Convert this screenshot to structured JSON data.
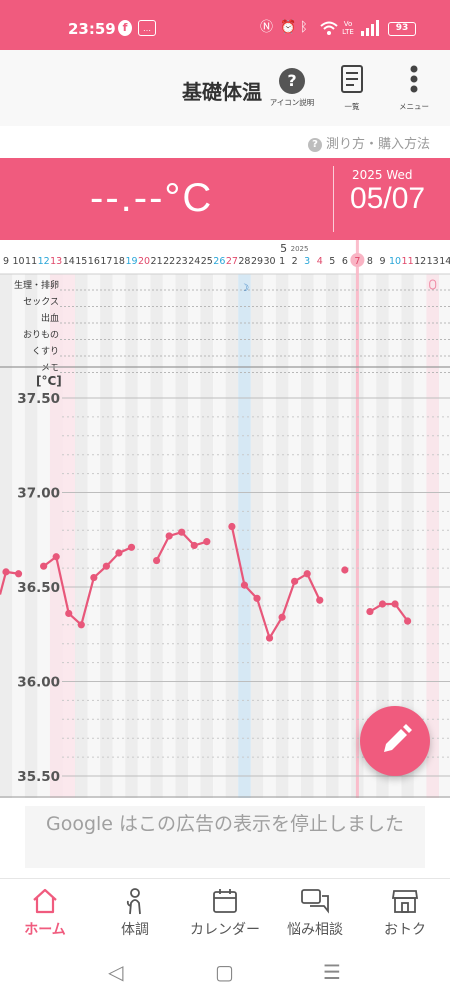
{
  "status_bar": {
    "time": "23:59",
    "battery": "93",
    "left_icons": [
      "facebook-icon",
      "message-icon"
    ],
    "right_icons": [
      "nfc-icon",
      "alarm-icon",
      "bluetooth-icon",
      "wifi-icon",
      "volte-icon",
      "signal-icon"
    ]
  },
  "header": {
    "title": "基礎体温",
    "help_label": "アイコン説明",
    "list_label": "一覧",
    "menu_label": "メニュー"
  },
  "howto": {
    "label": "測り方・購入方法"
  },
  "banner": {
    "temperature": "--.--°C",
    "year_day": "2025 Wed",
    "date": "05/07"
  },
  "chart": {
    "month_label": "5",
    "year_label": "2025",
    "day_labels": [
      "9",
      "10",
      "11",
      "12",
      "13",
      "14",
      "15",
      "16",
      "17",
      "18",
      "19",
      "20",
      "21",
      "22",
      "23",
      "24",
      "25",
      "26",
      "27",
      "28",
      "29",
      "30",
      "1",
      "2",
      "3",
      "4",
      "5",
      "6",
      "7",
      "8",
      "9",
      "10",
      "11",
      "12",
      "13",
      "14"
    ],
    "row_labels": [
      "生理・排卵",
      "セックス",
      "出血",
      "おりもの",
      "くすり",
      "メモ"
    ],
    "unit_label": "[°C]",
    "y_labels": [
      "37.50",
      "37.00",
      "36.50",
      "36.00",
      "35.50"
    ]
  },
  "chart_data": {
    "type": "line",
    "title": "",
    "xlabel": "",
    "ylabel": "[°C]",
    "ylim": [
      35.45,
      37.5
    ],
    "categories": [
      "4/9",
      "4/10",
      "4/11",
      "4/12",
      "4/13",
      "4/14",
      "4/15",
      "4/16",
      "4/17",
      "4/18",
      "4/19",
      "4/20",
      "4/21",
      "4/22",
      "4/23",
      "4/24",
      "4/25",
      "4/26",
      "4/27",
      "4/28",
      "4/29",
      "4/30",
      "5/1",
      "5/2",
      "5/3",
      "5/4",
      "5/5",
      "5/6",
      "5/7",
      "5/8",
      "5/9",
      "5/10",
      "5/11",
      "5/12",
      "5/13",
      "5/14"
    ],
    "series": [
      {
        "name": "",
        "values": [
          36.58,
          36.57,
          null,
          36.61,
          36.66,
          36.36,
          36.3,
          36.55,
          36.61,
          36.68,
          36.71,
          null,
          36.64,
          36.77,
          36.79,
          36.72,
          36.74,
          null,
          36.82,
          36.51,
          36.44,
          36.23,
          36.34,
          36.53,
          36.57,
          36.43,
          null,
          36.59,
          null,
          36.37,
          36.41,
          36.41,
          36.32,
          null,
          null,
          null
        ],
        "connect": [
          true,
          false,
          false,
          true,
          true,
          true,
          true,
          true,
          true,
          true,
          false,
          false,
          true,
          true,
          true,
          true,
          false,
          false,
          true,
          true,
          true,
          true,
          true,
          true,
          true,
          false,
          false,
          false,
          false,
          true,
          true,
          true,
          false,
          false,
          false,
          false
        ]
      }
    ],
    "weekday_colors": {
      "saturday": "#2aa6d8",
      "sunday": "#e0486a"
    },
    "selected_date": "5/7",
    "grid": true
  },
  "ad": {
    "text": "Google はこの広告の表示を停止しました"
  },
  "fab": {
    "icon": "pencil-icon"
  },
  "bottom_nav": [
    {
      "label": "ホーム",
      "icon": "home-icon",
      "active": true
    },
    {
      "label": "体調",
      "icon": "body-icon",
      "active": false
    },
    {
      "label": "カレンダー",
      "icon": "calendar-icon",
      "active": false
    },
    {
      "label": "悩み相談",
      "icon": "chat-icon",
      "active": false
    },
    {
      "label": "おトク",
      "icon": "shop-icon",
      "active": false
    }
  ],
  "colors": {
    "accent": "#f05b7e",
    "line": "#e8577a",
    "saturday": "#2aa6d8",
    "sunday": "#e0486a"
  }
}
